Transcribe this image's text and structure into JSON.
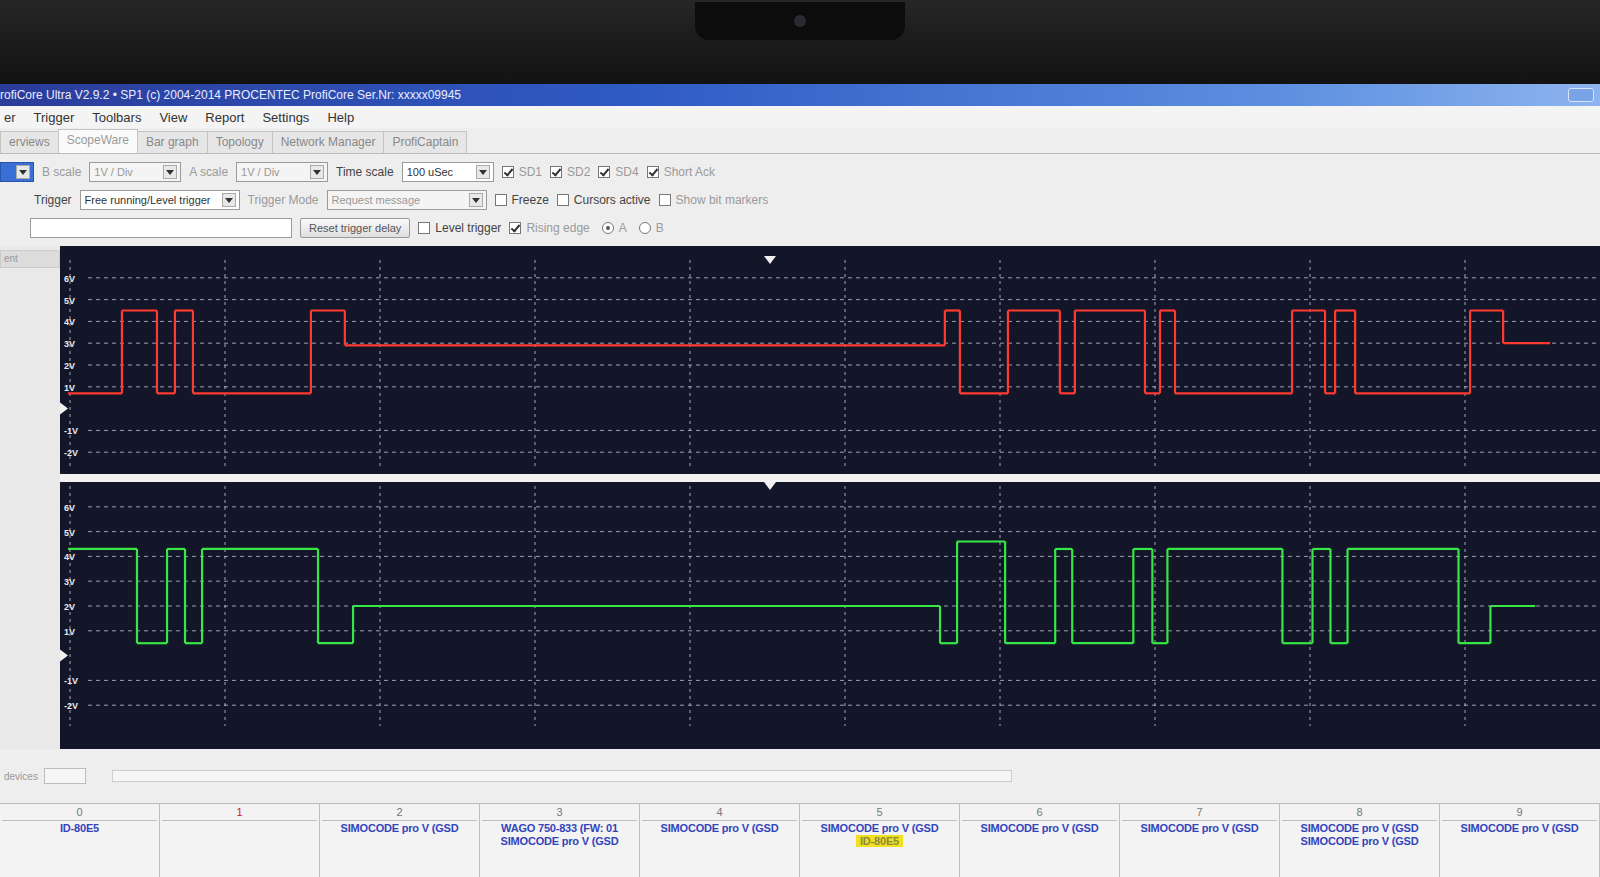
{
  "window": {
    "title": "rofiCore Ultra V2.9.2 • SP1 (c) 2004-2014 PROCENTEC ProfiCore Ser.Nr: xxxxx09945"
  },
  "menu": [
    "er",
    "Trigger",
    "Toolbars",
    "View",
    "Report",
    "Settings",
    "Help"
  ],
  "tabs": [
    {
      "label": "erviews",
      "selected": false
    },
    {
      "label": "ScopeWare",
      "selected": true
    },
    {
      "label": "Bar graph",
      "selected": false
    },
    {
      "label": "Topology",
      "selected": false
    },
    {
      "label": "Network Manager",
      "selected": false
    },
    {
      "label": "ProfiCaptain",
      "selected": false
    }
  ],
  "toolbar": [
    [
      {
        "kind": "select",
        "value": "",
        "disabled": false
      },
      {
        "kind": "label",
        "label": "B scale",
        "disabled": true
      },
      {
        "kind": "select",
        "value": "1V / Div",
        "disabled": true
      },
      {
        "kind": "label",
        "label": "A scale",
        "disabled": true
      },
      {
        "kind": "select",
        "value": "1V / Div",
        "disabled": true
      },
      {
        "kind": "label",
        "label": "Time scale",
        "disabled": false
      },
      {
        "kind": "select",
        "value": "100 uSec",
        "disabled": false
      },
      {
        "kind": "checkbox",
        "label": "SD1",
        "checked": true,
        "disabled": true
      },
      {
        "kind": "checkbox",
        "label": "SD2",
        "checked": true,
        "disabled": true
      },
      {
        "kind": "checkbox",
        "label": "SD4",
        "checked": true,
        "disabled": true
      },
      {
        "kind": "checkbox",
        "label": "Short Ack",
        "checked": true,
        "disabled": true
      }
    ],
    [
      {
        "kind": "label",
        "label": "Trigger",
        "disabled": false
      },
      {
        "kind": "select",
        "value": "Free running/Level trigger",
        "disabled": false
      },
      {
        "kind": "label",
        "label": "Trigger Mode",
        "disabled": true
      },
      {
        "kind": "select",
        "value": "Request message",
        "disabled": true
      },
      {
        "kind": "checkbox",
        "label": "Freeze",
        "checked": false,
        "disabled": false
      },
      {
        "kind": "checkbox",
        "label": "Cursors active",
        "checked": false,
        "disabled": false
      },
      {
        "kind": "checkbox",
        "label": "Show bit markers",
        "checked": false,
        "disabled": true
      }
    ],
    [
      {
        "kind": "input",
        "value": ""
      },
      {
        "kind": "button",
        "label": "Reset trigger delay"
      },
      {
        "kind": "checkbox",
        "label": "Level trigger",
        "checked": false,
        "disabled": false
      },
      {
        "kind": "checkbox",
        "label": "Rising edge",
        "checked": true,
        "disabled": true
      },
      {
        "kind": "radio",
        "label": "A",
        "selected": true,
        "disabled": true
      },
      {
        "kind": "radio",
        "label": "B",
        "selected": false,
        "disabled": true
      }
    ]
  ],
  "left_panel": {
    "header": "ent",
    "footer": "devices"
  },
  "scope": {
    "channels": [
      {
        "name": "B",
        "color": "#ff3b2f",
        "ticks": [
          {
            "label": "6V",
            "value": 6
          },
          {
            "label": "5V",
            "value": 5
          },
          {
            "label": "4V",
            "value": 4
          },
          {
            "label": "3V",
            "value": 3
          },
          {
            "label": "2V",
            "value": 2
          },
          {
            "label": "1V",
            "value": 1
          },
          {
            "label": "-1V",
            "value": -1
          },
          {
            "label": "-2V",
            "value": -2
          }
        ],
        "values": [
          0.7,
          4.5,
          0.7,
          4.5,
          0.7,
          4.5,
          2.9,
          4.5,
          0.7,
          4.5,
          0.7,
          4.5,
          0.7,
          4.5,
          0.7,
          4.5,
          0.7,
          4.5,
          0.7,
          4.5,
          3.0
        ],
        "durations_us": [
          34.8,
          22.6,
          11.6,
          11.6,
          76.1,
          21.9,
          387.1,
          9.7,
          31.0,
          33.5,
          9.7,
          45.2,
          9.7,
          9.7,
          75.5,
          21.3,
          6.5,
          12.9,
          74.2,
          21.3,
          30.3
        ]
      },
      {
        "name": "A",
        "color": "#35e845",
        "ticks": [
          {
            "label": "6V",
            "value": 6
          },
          {
            "label": "5V",
            "value": 5
          },
          {
            "label": "4V",
            "value": 4
          },
          {
            "label": "3V",
            "value": 3
          },
          {
            "label": "2V",
            "value": 2
          },
          {
            "label": "1V",
            "value": 1
          },
          {
            "label": "-1V",
            "value": -1
          },
          {
            "label": "-2V",
            "value": -2
          }
        ],
        "values": [
          4.3,
          0.5,
          4.3,
          0.5,
          4.3,
          0.5,
          2.0,
          0.5,
          4.6,
          0.5,
          4.3,
          0.5,
          4.3,
          0.5,
          4.3,
          0.5,
          4.3,
          0.5,
          4.3,
          0.5,
          2.0
        ],
        "durations_us": [
          44.5,
          19.4,
          11.6,
          11.0,
          74.8,
          22.6,
          378.7,
          11.0,
          31.0,
          32.3,
          11.0,
          39.4,
          12.3,
          9.7,
          74.2,
          19.4,
          11.6,
          11.0,
          71.6,
          20.6,
          29.0
        ]
      }
    ]
  },
  "devices": [
    {
      "number": "0",
      "alert": false,
      "entries": [
        {
          "text": "ID-80E5",
          "highlighted": false
        }
      ]
    },
    {
      "number": "1",
      "alert": true,
      "entries": []
    },
    {
      "number": "2",
      "alert": false,
      "entries": [
        {
          "text": "SIMOCODE pro V (GSD",
          "highlighted": false
        }
      ]
    },
    {
      "number": "3",
      "alert": false,
      "entries": [
        {
          "text": "WAGO 750-833 (FW: 01",
          "highlighted": false
        },
        {
          "text": "SIMOCODE pro V (GSD",
          "highlighted": false
        }
      ]
    },
    {
      "number": "4",
      "alert": false,
      "entries": [
        {
          "text": "SIMOCODE pro V (GSD",
          "highlighted": false
        }
      ]
    },
    {
      "number": "5",
      "alert": false,
      "entries": [
        {
          "text": "SIMOCODE pro V (GSD",
          "highlighted": false
        },
        {
          "text": "ID-80E5",
          "highlighted": true
        }
      ]
    },
    {
      "number": "6",
      "alert": false,
      "entries": [
        {
          "text": "SIMOCODE pro V (GSD",
          "highlighted": false
        }
      ]
    },
    {
      "number": "7",
      "alert": false,
      "entries": [
        {
          "text": "SIMOCODE pro V (GSD",
          "highlighted": false
        }
      ]
    },
    {
      "number": "8",
      "alert": false,
      "entries": [
        {
          "text": "SIMOCODE pro V (GSD",
          "highlighted": false
        },
        {
          "text": "SIMOCODE pro V (GSD",
          "highlighted": false
        }
      ]
    },
    {
      "number": "9",
      "alert": false,
      "entries": [
        {
          "text": "SIMOCODE pro V (GSD",
          "highlighted": false
        }
      ]
    }
  ]
}
